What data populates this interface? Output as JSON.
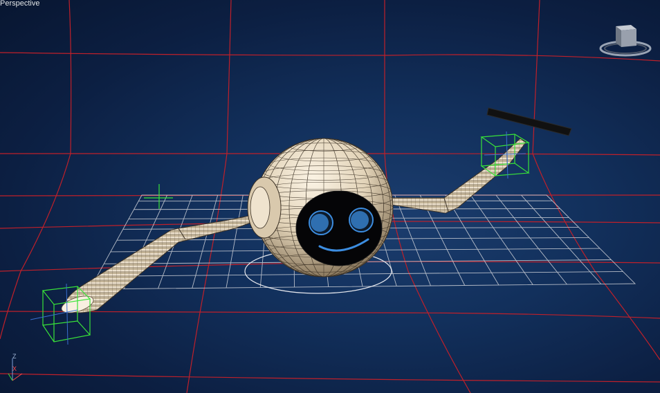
{
  "viewport": {
    "label": "Perspective",
    "background_colors": [
      "#1b3d6e",
      "#12305c",
      "#0c1f42",
      "#081631"
    ]
  },
  "scene_colors": {
    "red_grid": "#c0202a",
    "home_grid": "#c8ccd4",
    "selection_box": "#39e339",
    "mesh_fill": "#e8dcc8",
    "mesh_wire": "#3a3024",
    "eye_blue": "#2f6fb0",
    "mouth_blue": "#3c8de0"
  },
  "axis": {
    "z_label": "Z",
    "x_label": "X"
  },
  "icons": {
    "viewcube": "viewcube-icon",
    "tripod": "axis-tripod-icon"
  }
}
